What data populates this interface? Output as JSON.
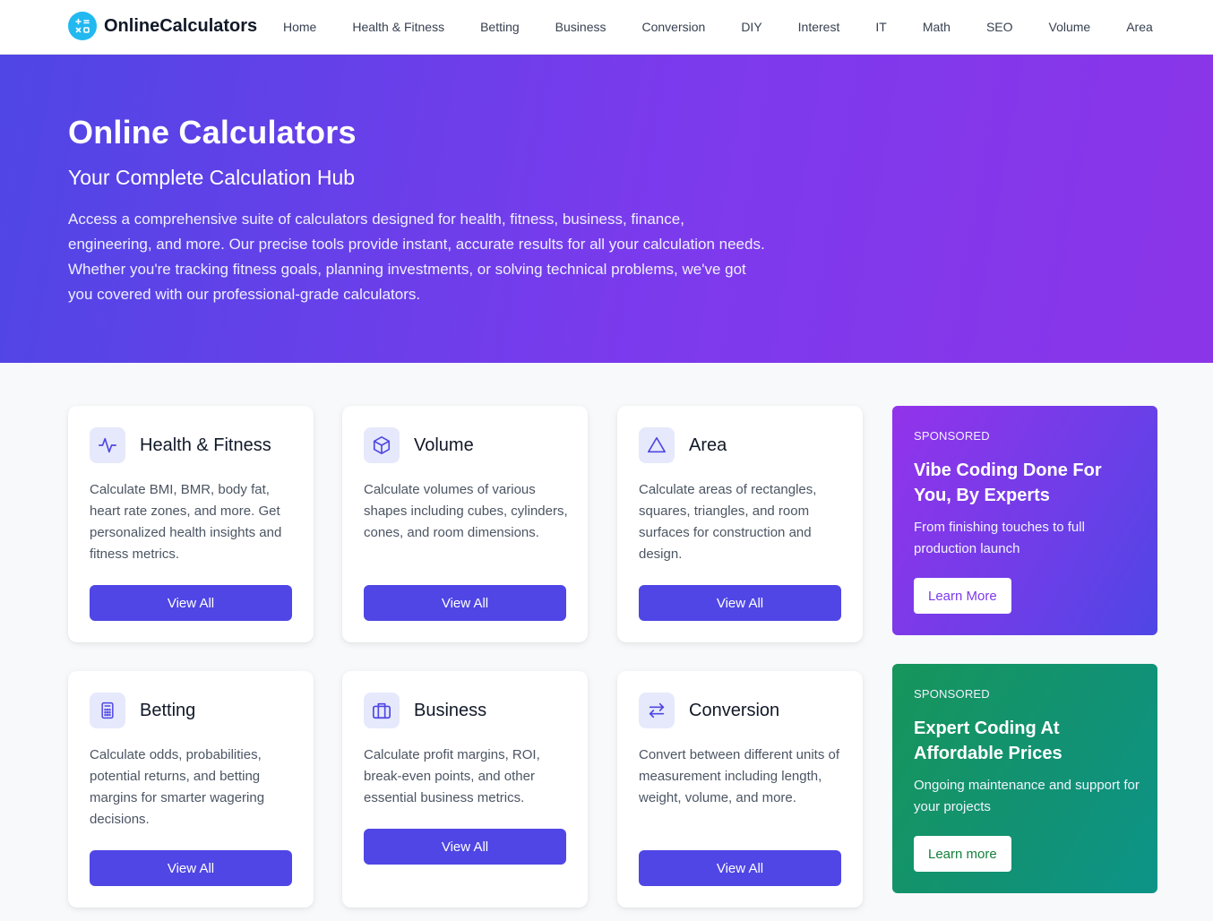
{
  "brand": {
    "name": "OnlineCalculators"
  },
  "nav": [
    "Home",
    "Health & Fitness",
    "Betting",
    "Business",
    "Conversion",
    "DIY",
    "Interest",
    "IT",
    "Math",
    "SEO",
    "Volume",
    "Area"
  ],
  "hero": {
    "title": "Online Calculators",
    "subtitle": "Your Complete Calculation Hub",
    "description": "Access a comprehensive suite of calculators designed for health, fitness, business, finance, engineering, and more. Our precise tools provide instant, accurate results for all your calculation needs. Whether you're tracking fitness goals, planning investments, or solving technical problems, we've got you covered with our professional-grade calculators."
  },
  "cards": [
    {
      "title": "Health & Fitness",
      "icon": "activity-icon",
      "description": "Calculate BMI, BMR, body fat, heart rate zones, and more. Get personalized health insights and fitness metrics.",
      "button": "View All"
    },
    {
      "title": "Volume",
      "icon": "cube-icon",
      "description": "Calculate volumes of various shapes including cubes, cylinders, cones, and room dimensions.",
      "button": "View All"
    },
    {
      "title": "Area",
      "icon": "triangle-icon",
      "description": "Calculate areas of rectangles, squares, triangles, and room surfaces for construction and design.",
      "button": "View All"
    },
    {
      "title": "Betting",
      "icon": "calculator-icon",
      "description": "Calculate odds, probabilities, potential returns, and betting margins for smarter wagering decisions.",
      "button": "View All"
    },
    {
      "title": "Business",
      "icon": "briefcase-icon",
      "description": "Calculate profit margins, ROI, break-even points, and other essential business metrics.",
      "button": "View All"
    },
    {
      "title": "Conversion",
      "icon": "arrows-swap-icon",
      "description": "Convert between different units of measurement including length, weight, volume, and more.",
      "button": "View All"
    }
  ],
  "ads": [
    {
      "tag": "SPONSORED",
      "title": "Vibe Coding Done For You, By Experts",
      "text": "From finishing touches to full production launch",
      "button": "Learn More"
    },
    {
      "tag": "SPONSORED",
      "title": "Expert Coding At Affordable Prices",
      "text": "Ongoing maintenance and support for your projects",
      "button": "Learn more"
    }
  ],
  "colors": {
    "accent": "#4f46e5",
    "hero_start": "#4f46e5",
    "hero_end": "#8b35e8",
    "ad_green": "#17955b",
    "brand_logo": "#22b8f0"
  }
}
